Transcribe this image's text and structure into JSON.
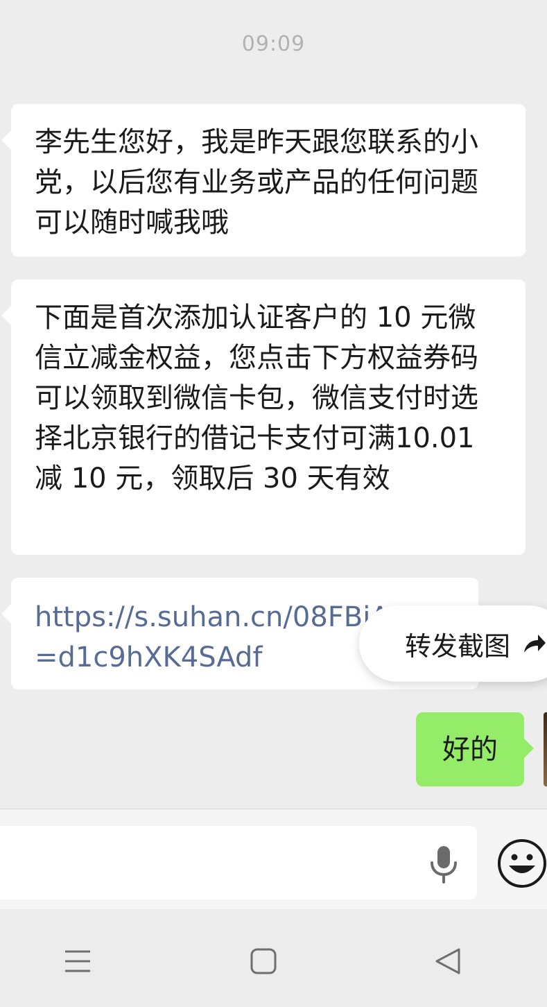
{
  "chat": {
    "timestamp": "09:09",
    "messages": [
      {
        "side": "left",
        "type": "text",
        "text": "李先生您好，我是昨天跟您联系的小党，以后您有业务或产品的任何问题可以随时喊我哦"
      },
      {
        "side": "left",
        "type": "text",
        "text": "下面是首次添加认证客户的 10 元微信立减金权益，您点击下方权益券码可以领取到微信卡包，微信支付时选择北京银行的借记卡支付可满10.01 减 10 元，领取后 30 天有效"
      },
      {
        "side": "left",
        "type": "link",
        "text": "https://s.suhan.cn/08FBiAD?s=d1c9hXK4SAdf"
      },
      {
        "side": "right",
        "type": "text",
        "text": "好的"
      }
    ]
  },
  "forward_screenshot": {
    "label": "转发截图",
    "icon": "share-arrow-icon"
  },
  "input_bar": {
    "mic_icon": "microphone-icon",
    "emoji_icon": "smiley-face-icon"
  },
  "nav_bar": {
    "icons": [
      "menu-icon",
      "home-square-icon",
      "back-triangle-icon"
    ]
  },
  "colors": {
    "background": "#ededed",
    "incoming_bubble": "#ffffff",
    "outgoing_bubble": "#95ec69",
    "link": "#576b95",
    "timestamp": "#b2b2b2"
  }
}
